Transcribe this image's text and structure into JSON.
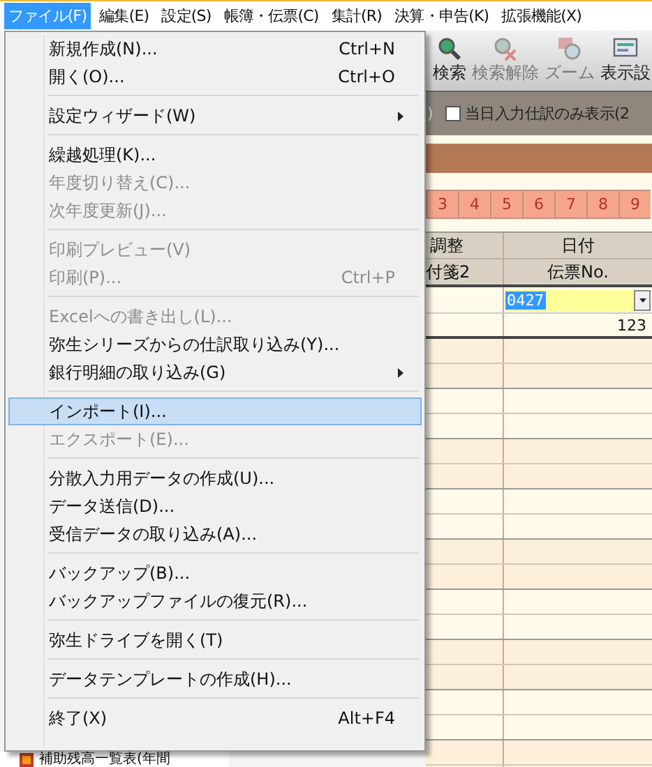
{
  "menubar": [
    {
      "label": "ファイル(F)",
      "selected": true
    },
    {
      "label": "編集(E)",
      "selected": false
    },
    {
      "label": "設定(S)",
      "selected": false
    },
    {
      "label": "帳簿・伝票(C)",
      "selected": false
    },
    {
      "label": "集計(R)",
      "selected": false
    },
    {
      "label": "決算・申告(K)",
      "selected": false
    },
    {
      "label": "拡張機能(X)",
      "selected": false
    }
  ],
  "toolbar": [
    {
      "kind": "search",
      "label": "検索",
      "disabled": false
    },
    {
      "kind": "clear-search",
      "label": "検索解除",
      "disabled": true
    },
    {
      "kind": "zoom",
      "label": "ズーム",
      "disabled": true
    },
    {
      "kind": "display",
      "label": "表示設",
      "disabled": false
    }
  ],
  "filter": {
    "fragment": ")",
    "checkbox": {
      "label": "当日入力仕訳のみ表示(2",
      "checked": false
    }
  },
  "month_tabs": [
    "3",
    "4",
    "5",
    "6",
    "7",
    "8",
    "9"
  ],
  "grid": {
    "header_rows": [
      [
        "調整",
        "日付"
      ],
      [
        "付箋2",
        "伝票No."
      ]
    ],
    "entry": {
      "date": "0427",
      "voucher_no": "123"
    }
  },
  "sidebar": {
    "items": [
      {
        "label": "補助残高一覧表(年間"
      }
    ]
  },
  "file_menu": [
    {
      "kind": "item",
      "label": "新規作成(N)...",
      "shortcut": "Ctrl+N",
      "disabled": false,
      "submenu": false,
      "selected": false
    },
    {
      "kind": "item",
      "label": "開く(O)...",
      "shortcut": "Ctrl+O",
      "disabled": false,
      "submenu": false,
      "selected": false
    },
    {
      "kind": "separator"
    },
    {
      "kind": "item",
      "label": "設定ウィザード(W)",
      "disabled": false,
      "submenu": true,
      "selected": false
    },
    {
      "kind": "separator"
    },
    {
      "kind": "item",
      "label": "繰越処理(K)...",
      "disabled": false,
      "submenu": false,
      "selected": false
    },
    {
      "kind": "item",
      "label": "年度切り替え(C)...",
      "disabled": true,
      "submenu": false,
      "selected": false
    },
    {
      "kind": "item",
      "label": "次年度更新(J)...",
      "disabled": true,
      "submenu": false,
      "selected": false
    },
    {
      "kind": "separator"
    },
    {
      "kind": "item",
      "label": "印刷プレビュー(V)",
      "disabled": true,
      "submenu": false,
      "selected": false
    },
    {
      "kind": "item",
      "label": "印刷(P)...",
      "shortcut": "Ctrl+P",
      "disabled": true,
      "submenu": false,
      "selected": false
    },
    {
      "kind": "separator"
    },
    {
      "kind": "item",
      "label": "Excelへの書き出し(L)...",
      "disabled": true,
      "submenu": false,
      "selected": false
    },
    {
      "kind": "item",
      "label": "弥生シリーズからの仕訳取り込み(Y)...",
      "disabled": false,
      "submenu": false,
      "selected": false
    },
    {
      "kind": "item",
      "label": "銀行明細の取り込み(G)",
      "disabled": false,
      "submenu": true,
      "selected": false
    },
    {
      "kind": "separator"
    },
    {
      "kind": "item",
      "label": "インポート(I)...",
      "disabled": false,
      "submenu": false,
      "selected": true
    },
    {
      "kind": "item",
      "label": "エクスポート(E)...",
      "disabled": true,
      "submenu": false,
      "selected": false
    },
    {
      "kind": "separator"
    },
    {
      "kind": "item",
      "label": "分散入力用データの作成(U)...",
      "disabled": false,
      "submenu": false,
      "selected": false
    },
    {
      "kind": "item",
      "label": "データ送信(D)...",
      "disabled": false,
      "submenu": false,
      "selected": false
    },
    {
      "kind": "item",
      "label": "受信データの取り込み(A)...",
      "disabled": false,
      "submenu": false,
      "selected": false
    },
    {
      "kind": "separator"
    },
    {
      "kind": "item",
      "label": "バックアップ(B)...",
      "disabled": false,
      "submenu": false,
      "selected": false
    },
    {
      "kind": "item",
      "label": "バックアップファイルの復元(R)...",
      "disabled": false,
      "submenu": false,
      "selected": false
    },
    {
      "kind": "separator"
    },
    {
      "kind": "item",
      "label": "弥生ドライブを開く(T)",
      "disabled": false,
      "submenu": false,
      "selected": false
    },
    {
      "kind": "separator"
    },
    {
      "kind": "item",
      "label": "データテンプレートの作成(H)...",
      "disabled": false,
      "submenu": false,
      "selected": false
    },
    {
      "kind": "separator"
    },
    {
      "kind": "item",
      "label": "終了(X)",
      "shortcut": "Alt+F4",
      "disabled": false,
      "submenu": false,
      "selected": false
    }
  ]
}
